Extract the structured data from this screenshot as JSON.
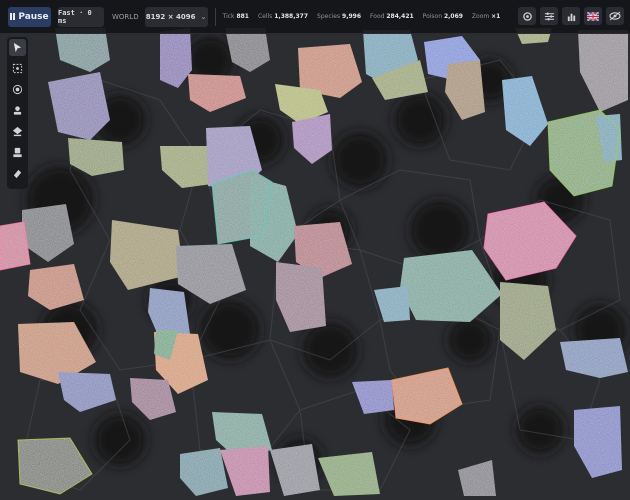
{
  "controls": {
    "pause_label": "Pause",
    "speed_value": "Fast · 0 ms",
    "world_label": "WORLD",
    "world_size": "8192 × 4096"
  },
  "stats": [
    {
      "label": "Tick",
      "value": "881"
    },
    {
      "label": "Cells",
      "value": "1,388,377"
    },
    {
      "label": "Species",
      "value": "9,996"
    },
    {
      "label": "Food",
      "value": "284,421"
    },
    {
      "label": "Poison",
      "value": "2,069"
    },
    {
      "label": "Zoom",
      "value": "×1"
    }
  ],
  "right_icons": [
    "settings-icon",
    "sliders-icon",
    "bar-chart-icon",
    "uk-flag-icon",
    "eye-icon"
  ],
  "tools": [
    "pointer-tool-icon",
    "select-region-icon",
    "camera-icon",
    "spawn-tool-icon",
    "eraser-stack-icon",
    "stamp-tool-icon",
    "eraser-icon"
  ],
  "colors": {
    "background": "#1b1c1f",
    "accent": "#2b3d63"
  }
}
